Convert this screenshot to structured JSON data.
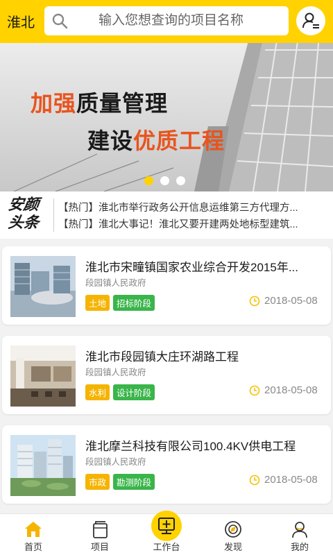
{
  "header": {
    "city": "淮北",
    "search_placeholder": "输入您想查询的项目名称",
    "search_icon": "search-icon",
    "user_icon": "user-list-icon"
  },
  "banner": {
    "line1_hl": "加强",
    "line1_rest": "质量管理",
    "line2_rest": "建设",
    "line2_hl": "优质工程",
    "slides": 3,
    "active_slide": 0
  },
  "headlines": {
    "logo_line1": "安颜",
    "logo_line2": "头条",
    "items": [
      "【热门】淮北市举行政务公开信息运维第三方代理方...",
      "【热门】淮北大事记！淮北又要开建两处地标型建筑..."
    ]
  },
  "projects": [
    {
      "title": "淮北市宋疃镇国家农业综合开发2015年...",
      "owner": "段园镇人民政府",
      "tag1": "土地",
      "tag2": "招标阶段",
      "date": "2018-05-08"
    },
    {
      "title": "淮北市段园镇大庄环湖路工程",
      "owner": "段园镇人民政府",
      "tag1": "水利",
      "tag2": "设计阶段",
      "date": "2018-05-08"
    },
    {
      "title": "淮北摩兰科技有限公司100.4KV供电工程",
      "owner": "段园镇人民政府",
      "tag1": "市政",
      "tag2": "勘测阶段",
      "date": "2018-05-08"
    }
  ],
  "nav": [
    {
      "label": "首页",
      "icon": "home-icon"
    },
    {
      "label": "项目",
      "icon": "project-icon"
    },
    {
      "label": "工作台",
      "icon": "workbench-icon"
    },
    {
      "label": "发现",
      "icon": "discover-icon"
    },
    {
      "label": "我的",
      "icon": "profile-icon"
    }
  ],
  "colors": {
    "accent": "#ffd200",
    "highlight": "#e8541e",
    "tag_yellow": "#f5b400",
    "tag_green": "#3ab54a"
  }
}
